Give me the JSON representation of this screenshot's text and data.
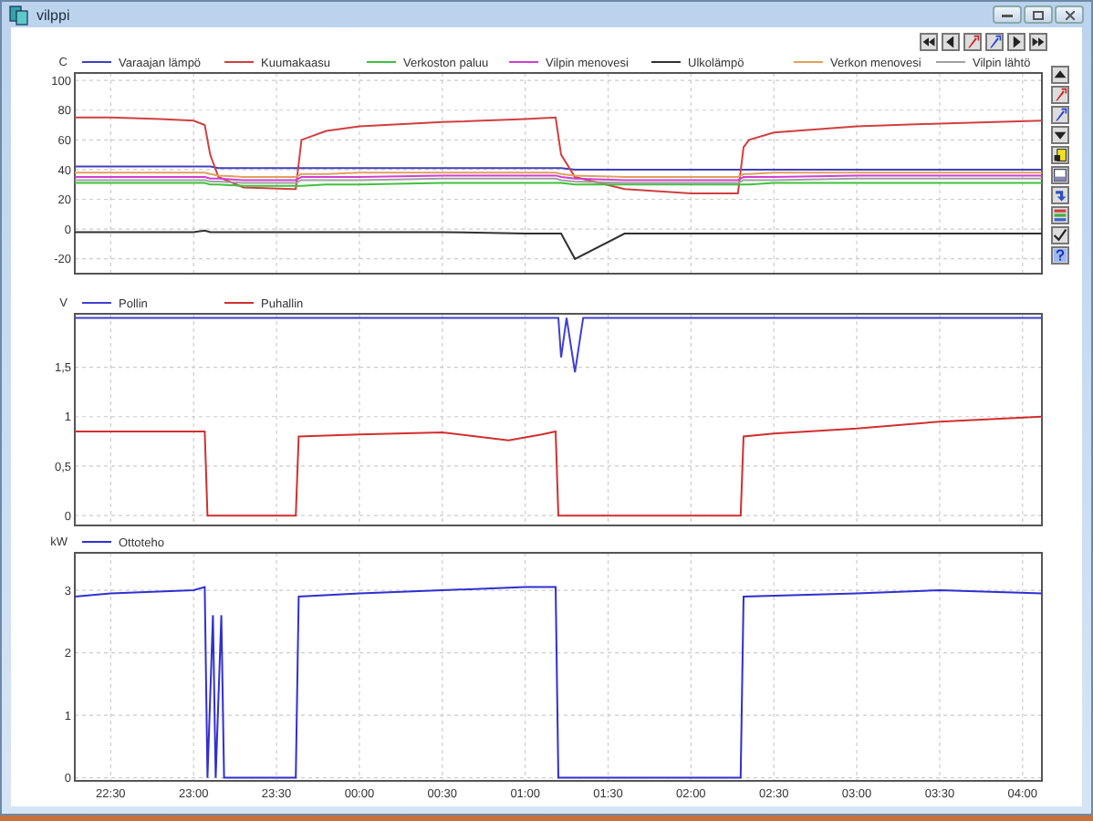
{
  "window": {
    "title": "vilppi"
  },
  "charts": [
    {
      "chart_data": {
        "type": "line",
        "ylabel": "C",
        "x": [
          "2000-01-01 22:17",
          "2000-01-01 22:30",
          "2000-01-01 22:48",
          "2000-01-01 23:00",
          "2000-01-01 23:04",
          "2000-01-01 23:06",
          "2000-01-01 23:09",
          "2000-01-01 23:18",
          "2000-01-01 23:36",
          "2000-01-01 23:37",
          "2000-01-01 23:39",
          "2000-01-01 23:48",
          "2000-01-02 00:00",
          "2000-01-02 00:30",
          "2000-01-02 01:00",
          "2000-01-02 01:11",
          "2000-01-02 01:13",
          "2000-01-02 01:18",
          "2000-01-02 01:36",
          "2000-01-02 02:00",
          "2000-01-02 02:17",
          "2000-01-02 02:19",
          "2000-01-02 02:21",
          "2000-01-02 02:30",
          "2000-01-02 03:00",
          "2000-01-02 03:30",
          "2000-01-02 04:07"
        ],
        "series": [
          {
            "name": "Varaajan lämpö",
            "color": "#4040c0",
            "values": [
              42,
              42,
              42,
              42,
              42,
              42,
              41,
              41,
              41,
              41,
              41,
              41,
              41,
              41,
              41,
              41,
              41,
              40,
              40,
              40,
              40,
              40,
              40,
              40,
              40,
              40,
              40
            ]
          },
          {
            "name": "Kuumakaasu",
            "color": "#d04040",
            "values": [
              75,
              75,
              74,
              73,
              70,
              50,
              35,
              28,
              27,
              27,
              60,
              66,
              69,
              72,
              74,
              75,
              50,
              35,
              27,
              24,
              24,
              55,
              60,
              65,
              69,
              71,
              73
            ]
          },
          {
            "name": "Verkoston paluu",
            "color": "#40c040",
            "values": [
              31,
              31,
              31,
              31,
              31,
              30,
              30,
              29,
              29,
              29,
              29,
              30,
              30,
              31,
              31,
              31,
              31,
              30,
              30,
              30,
              30,
              30,
              30,
              31,
              31,
              31,
              31
            ]
          },
          {
            "name": "Vilpin menovesi",
            "color": "#d040d0",
            "values": [
              35,
              35,
              35,
              35,
              35,
              34,
              34,
              33,
              33,
              33,
              35,
              35,
              35,
              36,
              36,
              36,
              35,
              34,
              33,
              33,
              33,
              35,
              35,
              35,
              36,
              36,
              36
            ]
          },
          {
            "name": "Ulkolämpö",
            "color": "#303030",
            "values": [
              -2,
              -2,
              -2,
              -2,
              -1,
              -2,
              -2,
              -2,
              -2,
              -2,
              -2,
              -2,
              -2,
              -2,
              -3,
              -3,
              -3,
              -20,
              -3,
              -3,
              -3,
              -3,
              -3,
              -3,
              -3,
              -3,
              -3
            ]
          },
          {
            "name": "Verkon menovesi",
            "color": "#e0a060",
            "values": [
              38,
              38,
              38,
              38,
              38,
              37,
              36,
              35,
              35,
              35,
              37,
              37,
              38,
              38,
              38,
              38,
              37,
              36,
              35,
              35,
              35,
              37,
              37,
              38,
              38,
              38,
              38
            ]
          },
          {
            "name": "Vilpin lähtö",
            "color": "#a0a0a0",
            "values": [
              33,
              33,
              33,
              33,
              33,
              32,
              32,
              31,
              31,
              31,
              33,
              33,
              33,
              34,
              34,
              34,
              33,
              32,
              31,
              31,
              31,
              33,
              33,
              33,
              34,
              34,
              34
            ]
          }
        ],
        "ylim": [
          -30,
          105
        ],
        "yticks": [
          {
            "value": -20,
            "label": "-20"
          },
          {
            "value": 0,
            "label": "0"
          },
          {
            "value": 20,
            "label": "20"
          },
          {
            "value": 40,
            "label": "40"
          },
          {
            "value": 60,
            "label": "60"
          },
          {
            "value": 80,
            "label": "80"
          },
          {
            "value": 100,
            "label": "100"
          }
        ],
        "xlim": [
          "2000-01-01 22:17",
          "2000-01-02 04:07"
        ],
        "grid": true,
        "legend": "top"
      }
    },
    {
      "chart_data": {
        "type": "line",
        "ylabel": "V",
        "x": [
          "2000-01-01 22:17",
          "2000-01-01 23:04",
          "2000-01-01 23:05",
          "2000-01-01 23:37",
          "2000-01-01 23:38",
          "2000-01-02 00:00",
          "2000-01-02 00:30",
          "2000-01-02 00:54",
          "2000-01-02 01:06",
          "2000-01-02 01:11",
          "2000-01-02 01:12",
          "2000-01-02 01:13",
          "2000-01-02 01:15",
          "2000-01-02 01:18",
          "2000-01-02 01:21",
          "2000-01-02 02:18",
          "2000-01-02 02:19",
          "2000-01-02 02:30",
          "2000-01-02 03:00",
          "2000-01-02 03:30",
          "2000-01-02 04:07"
        ],
        "series": [
          {
            "name": "Pollin",
            "color": "#4040d0",
            "values": [
              2,
              2,
              2,
              2,
              2,
              2,
              2,
              2,
              2,
              2,
              2,
              1.6,
              2,
              1.45,
              2,
              2,
              2,
              2,
              2,
              2,
              2
            ]
          },
          {
            "name": "Puhallin",
            "color": "#d03030",
            "values": [
              0.85,
              0.85,
              0,
              0,
              0.8,
              0.82,
              0.84,
              0.76,
              0.82,
              0.85,
              0,
              0,
              0,
              0,
              0,
              0,
              0.8,
              0.83,
              0.88,
              0.95,
              1.0
            ]
          }
        ],
        "ylim": [
          -0.1,
          2.04
        ],
        "yticks": [
          {
            "value": 0,
            "label": "0"
          },
          {
            "value": 0.5,
            "label": "0,5"
          },
          {
            "value": 1,
            "label": "1"
          },
          {
            "value": 1.5,
            "label": "1,5"
          }
        ],
        "xlim": [
          "2000-01-01 22:17",
          "2000-01-02 04:07"
        ],
        "grid": true,
        "legend": "top"
      }
    },
    {
      "chart_data": {
        "type": "line",
        "ylabel": "kW",
        "x": [
          "2000-01-01 22:17",
          "2000-01-01 22:30",
          "2000-01-01 23:00",
          "2000-01-01 23:04",
          "2000-01-01 23:05",
          "2000-01-01 23:07",
          "2000-01-01 23:08",
          "2000-01-01 23:10",
          "2000-01-01 23:11",
          "2000-01-01 23:37",
          "2000-01-01 23:38",
          "2000-01-02 00:00",
          "2000-01-02 00:30",
          "2000-01-02 01:00",
          "2000-01-02 01:11",
          "2000-01-02 01:12",
          "2000-01-02 02:18",
          "2000-01-02 02:19",
          "2000-01-02 03:00",
          "2000-01-02 03:30",
          "2000-01-02 04:07"
        ],
        "series": [
          {
            "name": "Ottoteho",
            "color": "#3030d0",
            "values": [
              2.9,
              2.95,
              3.0,
              3.05,
              0,
              2.6,
              0,
              2.6,
              0,
              0,
              2.9,
              2.95,
              3.0,
              3.05,
              3.05,
              0,
              0,
              2.9,
              2.95,
              3.0,
              2.95
            ]
          }
        ],
        "ylim": [
          -0.05,
          3.6
        ],
        "grid": true,
        "legend": "top",
        "yticks": [
          {
            "value": 0,
            "label": "0"
          },
          {
            "value": 1,
            "label": "1"
          },
          {
            "value": 2,
            "label": "2"
          },
          {
            "value": 3,
            "label": "3"
          }
        ],
        "xlim": [
          "2000-01-01 22:17",
          "2000-01-02 04:07"
        ],
        "xticks": [
          {
            "value": "2000-01-01 22:30",
            "label": "22:30"
          },
          {
            "value": "2000-01-01 23:00",
            "label": "23:00"
          },
          {
            "value": "2000-01-01 23:30",
            "label": "23:30"
          },
          {
            "value": "2000-01-02 00:00",
            "label": "00:00"
          },
          {
            "value": "2000-01-02 00:30",
            "label": "00:30"
          },
          {
            "value": "2000-01-02 01:00",
            "label": "01:00"
          },
          {
            "value": "2000-01-02 01:30",
            "label": "01:30"
          },
          {
            "value": "2000-01-02 02:00",
            "label": "02:00"
          },
          {
            "value": "2000-01-02 02:30",
            "label": "02:30"
          },
          {
            "value": "2000-01-02 03:00",
            "label": "03:00"
          },
          {
            "value": "2000-01-02 03:30",
            "label": "03:30"
          },
          {
            "value": "2000-01-02 04:00",
            "label": "04:00"
          }
        ]
      }
    }
  ]
}
